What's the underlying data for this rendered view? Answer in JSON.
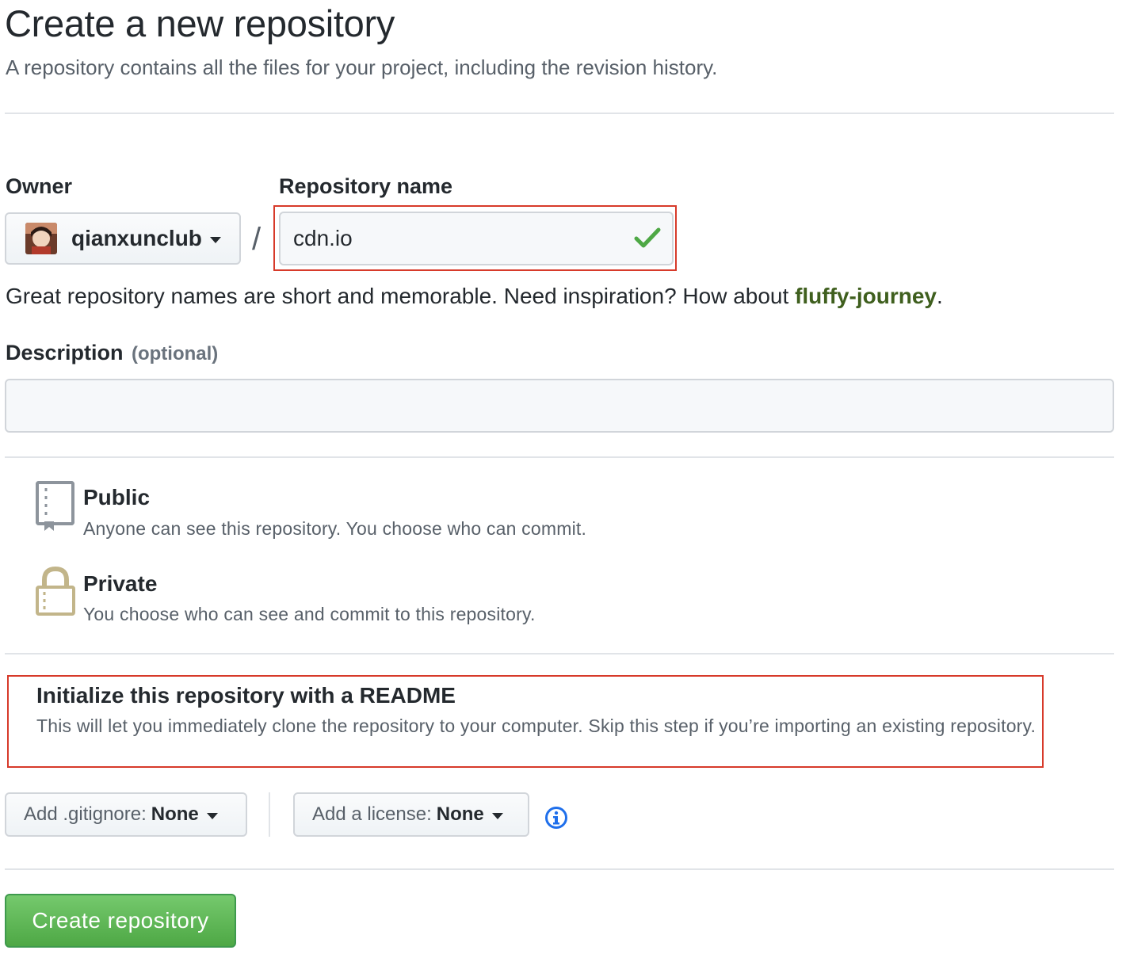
{
  "header": {
    "title": "Create a new repository",
    "subtitle": "A repository contains all the files for your project, including the revision history."
  },
  "owner": {
    "label": "Owner",
    "name": "qianxunclub"
  },
  "separator": "/",
  "repository": {
    "label": "Repository name",
    "value": "cdn.io",
    "valid": true
  },
  "hint": {
    "text": "Great repository names are short and memorable. Need inspiration? How about ",
    "suggestion": "fluffy-journey",
    "end": "."
  },
  "description": {
    "label": "Description",
    "optional": "(optional)",
    "value": ""
  },
  "visibility": {
    "public": {
      "title": "Public",
      "description": "Anyone can see this repository. You choose who can commit."
    },
    "private": {
      "title": "Private",
      "description": "You choose who can see and commit to this repository."
    }
  },
  "readme": {
    "title": "Initialize this repository with a README",
    "description": "This will let you immediately clone the repository to your computer. Skip this step if you’re importing an existing repository."
  },
  "gitignore": {
    "prefix": "Add .gitignore:",
    "value": "None"
  },
  "license": {
    "prefix": "Add a license:",
    "value": "None"
  },
  "submit": {
    "label": "Create repository"
  },
  "colors": {
    "accent_green": "#4ea845",
    "highlight_red": "#d73a2a",
    "suggestion_green": "#3f5f1e",
    "info_blue": "#1f6feb"
  }
}
